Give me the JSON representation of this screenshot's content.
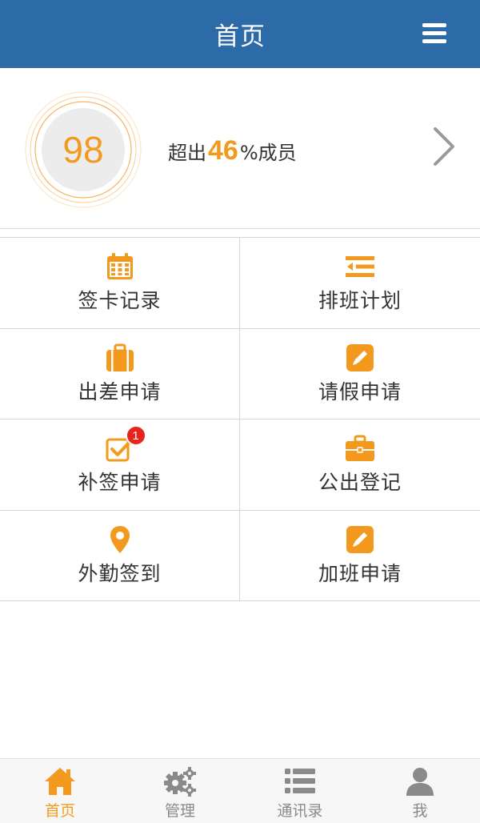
{
  "header": {
    "title": "首页",
    "menu_icon": "hamburger-menu-icon"
  },
  "score": {
    "value": "98",
    "prefix": "超出",
    "percent": "46",
    "suffix": "%成员",
    "accent_color": "#f39a1e"
  },
  "grid": [
    {
      "label": "签卡记录",
      "icon": "calendar-icon"
    },
    {
      "label": "排班计划",
      "icon": "indent-list-icon"
    },
    {
      "label": "出差申请",
      "icon": "suitcase-icon"
    },
    {
      "label": "请假申请",
      "icon": "pencil-edit-icon"
    },
    {
      "label": "补签申请",
      "icon": "checkbox-icon",
      "badge": "1"
    },
    {
      "label": "公出登记",
      "icon": "briefcase-icon"
    },
    {
      "label": "外勤签到",
      "icon": "location-pin-icon"
    },
    {
      "label": "加班申请",
      "icon": "pencil-edit-icon"
    }
  ],
  "tabs": [
    {
      "label": "首页",
      "icon": "home-icon",
      "active": true
    },
    {
      "label": "管理",
      "icon": "gears-icon",
      "active": false
    },
    {
      "label": "通讯录",
      "icon": "list-icon",
      "active": false
    },
    {
      "label": "我",
      "icon": "user-icon",
      "active": false
    }
  ],
  "colors": {
    "header": "#2d6aa8",
    "accent": "#f39a1e",
    "badge": "#e8231c"
  }
}
